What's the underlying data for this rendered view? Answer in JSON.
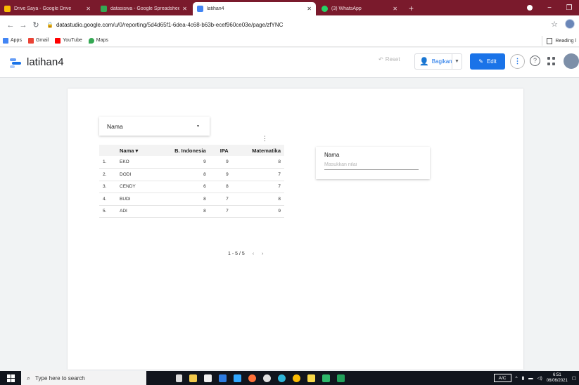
{
  "browser": {
    "tabs": [
      {
        "label": "Drive Saya - Google Drive",
        "color": "#fbbc04"
      },
      {
        "label": "datasiswa - Google Spreadsheet",
        "color": "#34a853"
      },
      {
        "label": "latihan4",
        "color": "#4285f4"
      },
      {
        "label": "(3) WhatsApp",
        "color": "#25d366"
      }
    ],
    "new_tab": "+",
    "url_host": "datastudio.google.com",
    "url_path": "/u/0/reporting/5d4d65f1-6dea-4c68-b63b-ecef960ce03e/page/zfYNC",
    "bookmarks": [
      {
        "label": "Apps",
        "color": "#4285f4"
      },
      {
        "label": "Gmail",
        "color": "#ea4335"
      },
      {
        "label": "YouTube",
        "color": "#ff0000"
      },
      {
        "label": "Maps",
        "color": "#34a853"
      }
    ],
    "reading_list": "Reading l"
  },
  "header": {
    "title": "latihan4",
    "reset_label": "Reset",
    "share_label": "Bagikan",
    "edit_label": "Edit"
  },
  "report": {
    "dropdown_label": "Nama",
    "table": {
      "columns": [
        "Nama",
        "B. Indonesia",
        "IPA",
        "Matematika"
      ],
      "sort_indicator": "▾",
      "rows": [
        {
          "no": "1.",
          "nama": "EKO",
          "bindo": "9",
          "ipa": "9",
          "mtk": "8"
        },
        {
          "no": "2.",
          "nama": "DODI",
          "bindo": "8",
          "ipa": "9",
          "mtk": "7"
        },
        {
          "no": "3.",
          "nama": "CENDY",
          "bindo": "6",
          "ipa": "8",
          "mtk": "7"
        },
        {
          "no": "4.",
          "nama": "BUDI",
          "bindo": "8",
          "ipa": "7",
          "mtk": "8"
        },
        {
          "no": "5.",
          "nama": "ADI",
          "bindo": "8",
          "ipa": "7",
          "mtk": "9"
        }
      ]
    },
    "pagination": {
      "range": "1 - 5 / 5",
      "prev": "‹",
      "next": "›"
    },
    "input_box": {
      "label": "Nama",
      "placeholder": "Masukkan nilai"
    }
  },
  "taskbar": {
    "search_placeholder": "Type here to search",
    "ac_label": "A/C",
    "time": "6:51",
    "date": "06/06/2021"
  },
  "colors": {
    "tab_strip": "#7a1a2c",
    "accent": "#1a73e8"
  }
}
